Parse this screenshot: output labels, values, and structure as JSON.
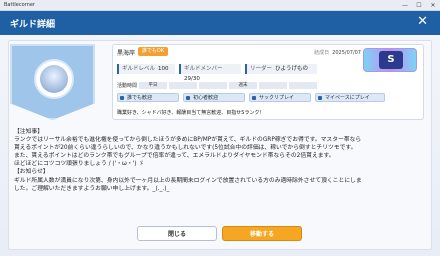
{
  "window": {
    "title": "Battlecorner",
    "controls": [
      "—",
      "☐",
      "✕"
    ]
  },
  "dialog": {
    "title": "ギルド詳細",
    "close_glyph": "✕"
  },
  "guild": {
    "name": "黒海岸",
    "ok_badge": "誰でもOK",
    "founded_label": "結成日",
    "founded_date": "2025/07/07",
    "rank": "S",
    "stats": [
      {
        "label": "ギルドレベル",
        "value": "100"
      },
      {
        "label": "ギルドメンバー",
        "value": "29/30"
      },
      {
        "label": "リーダー",
        "value": "ひようげもの"
      }
    ],
    "activity_label": "活動時間",
    "activity_days": [
      "平日",
      "",
      "",
      "週末",
      "",
      ""
    ],
    "tags": [
      "誰でも歓迎",
      "初心者歓迎",
      "サックリプレイ",
      "マイペースにプレイ"
    ],
    "tag_text": "職業好き、シャドバ好き、報酬目当て無言歓迎、目指せSランク！"
  },
  "description": [
    "【注知事】",
    "ランクではリーサル余裕でも進化権を使ってから倒したほうが多めにBP/MPが貰えて、ギルドのGRP稼ぎでお得です。マスター帯なら",
    "貰えるポイントが20前くらい違うらしいので、かなり違うかもしれないです(5位試合中の評価は、稼いでから倒すとチリツモです。",
    "また、貰えるポイントはどのランク帯でもグループで倍率が違って、エメラルドよりダイヤモンド帯ならその2倍貰えます。",
    "ほどほどにコツコツ頑張りましょう / ('・ω・') ゞ",
    "【お知らせ】",
    "ギルド所属人数が満員になり次第、身内以外で一ヶ月以上の長期間未ログインで放置されている方のみ適時除外させて頂くことにしま",
    "した。ご理解いただきますようお願い申し上げます。_(._.)_"
  ],
  "buttons": {
    "close": "閉じる",
    "move": "移動する"
  }
}
